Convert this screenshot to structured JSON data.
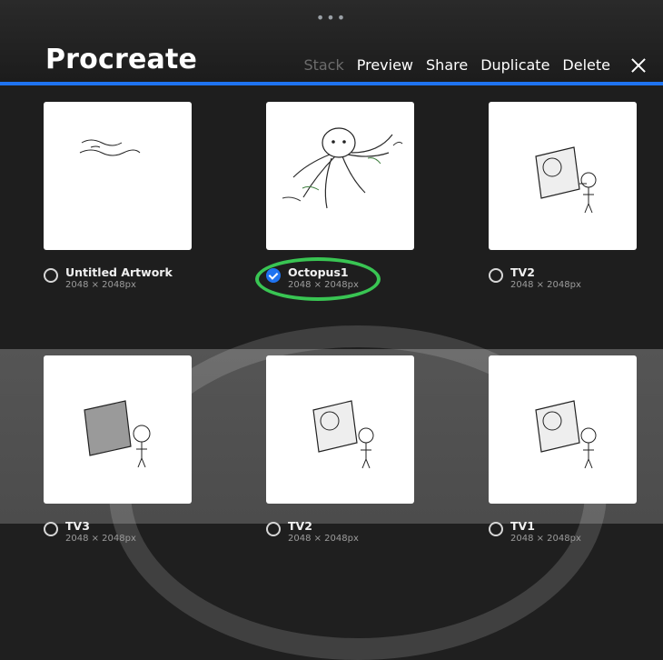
{
  "ui": {
    "dots": "•••",
    "title": "Procreate",
    "actions": {
      "stack": "Stack",
      "preview": "Preview",
      "share": "Share",
      "duplicate": "Duplicate",
      "delete": "Delete"
    },
    "accent_color": "#1f73f0",
    "highlight_color": "#39c553"
  },
  "gallery": {
    "items": [
      {
        "name": "Untitled Artwork",
        "dims": "2048 × 2048px",
        "selected": false
      },
      {
        "name": "Octopus1",
        "dims": "2048 × 2048px",
        "selected": true
      },
      {
        "name": "TV2",
        "dims": "2048 × 2048px",
        "selected": false
      },
      {
        "name": "TV3",
        "dims": "2048 × 2048px",
        "selected": false
      },
      {
        "name": "TV2",
        "dims": "2048 × 2048px",
        "selected": false
      },
      {
        "name": "TV1",
        "dims": "2048 × 2048px",
        "selected": false
      }
    ]
  }
}
